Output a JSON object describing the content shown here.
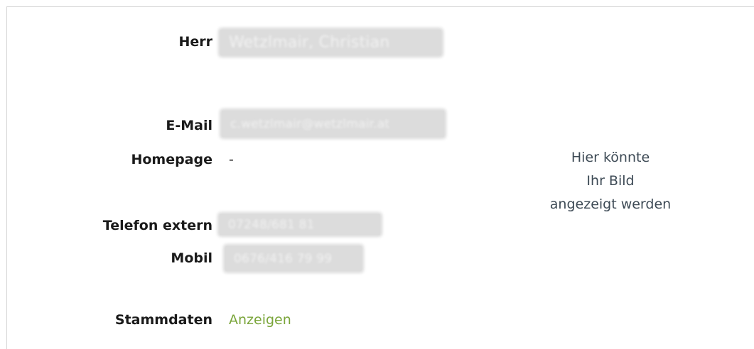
{
  "contact": {
    "salutation_label": "Herr",
    "name_value": "Wetzlmair, Christian",
    "email_label": "E-Mail",
    "email_value": "c.wetzlmair@wetzlmair.at",
    "homepage_label": "Homepage",
    "homepage_value": "-",
    "phone_external_label": "Telefon extern",
    "phone_external_value": "07248/681 81",
    "mobile_label": "Mobil",
    "mobile_value": "0676/416 79 99",
    "master_data_label": "Stammdaten",
    "master_data_link": "Anzeigen"
  },
  "image_placeholder": {
    "line1": "Hier könnte",
    "line2": "Ihr Bild",
    "line3": "angezeigt werden"
  },
  "colors": {
    "link": "#7aa53a",
    "label": "#1a1a1a",
    "placeholder_text": "#3d4a55",
    "redaction": "#dcdcdc"
  }
}
